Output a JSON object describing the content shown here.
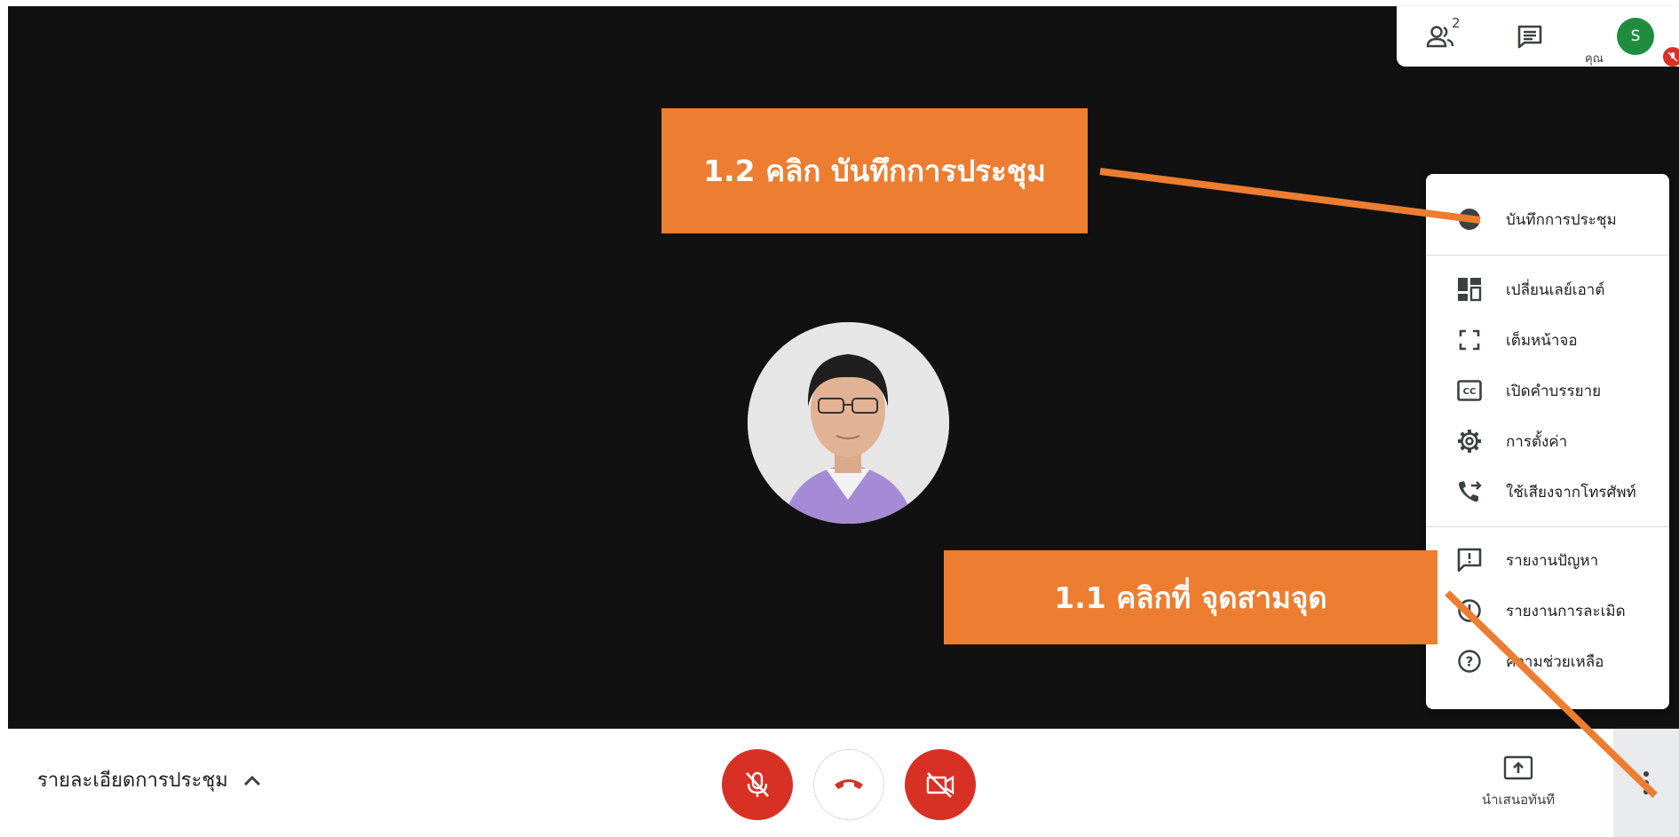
{
  "top_panel": {
    "people_count": "2",
    "you_label": "คุณ",
    "avatar_initial": "S"
  },
  "callouts": {
    "step_1_2": "1.2 คลิก บันทึกการประชุม",
    "step_1_1": "1.1 คลิกที่ จุดสามจุด"
  },
  "menu": {
    "items": [
      {
        "label": "บันทึกการประชุม",
        "icon": "record-icon"
      },
      {
        "label": "เปลี่ยนเลย์เอาต์",
        "icon": "layout-icon"
      },
      {
        "label": "เต็มหน้าจอ",
        "icon": "fullscreen-icon"
      },
      {
        "label": "เปิดคำบรรยาย",
        "icon": "captions-icon"
      },
      {
        "label": "การตั้งค่า",
        "icon": "gear-icon"
      },
      {
        "label": "ใช้เสียงจากโทรศัพท์",
        "icon": "phone-forward-icon"
      },
      {
        "label": "รายงานปัญหา",
        "icon": "feedback-icon"
      },
      {
        "label": "รายงานการละเมิด",
        "icon": "report-abuse-icon"
      },
      {
        "label": "ความช่วยเหลือ",
        "icon": "help-icon"
      }
    ]
  },
  "bottom_bar": {
    "meeting_details": "รายละเอียดการประชุม",
    "present_label": "นำเสนอทันที"
  },
  "colors": {
    "stage": "#111111",
    "callout": "#ed7d31",
    "danger": "#d93025",
    "avatar": "#1e8e3e"
  }
}
